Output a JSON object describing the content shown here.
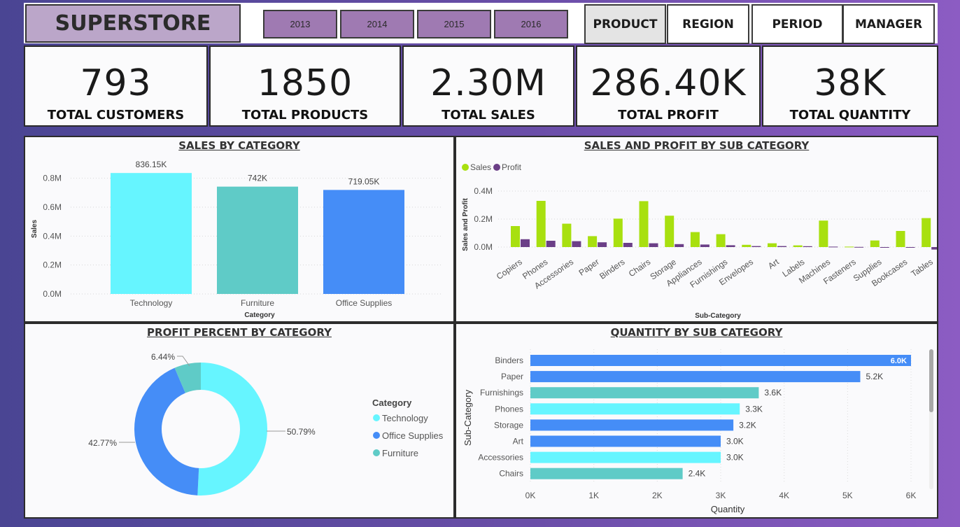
{
  "header": {
    "title": "SUPERSTORE",
    "years": [
      "2013",
      "2014",
      "2015",
      "2016"
    ],
    "nav": [
      "PRODUCT",
      "REGION",
      "PERIOD",
      "MANAGER"
    ]
  },
  "kpis": [
    {
      "value": "793",
      "label": "TOTAL CUSTOMERS"
    },
    {
      "value": "1850",
      "label": "TOTAL PRODUCTS"
    },
    {
      "value": "2.30M",
      "label": "TOTAL SALES"
    },
    {
      "value": "286.40K",
      "label": "TOTAL PROFIT"
    },
    {
      "value": "38K",
      "label": "TOTAL QUANTITY"
    }
  ],
  "charts": {
    "sales_by_category": "SALES BY CATEGORY",
    "sales_profit_sub": "SALES AND PROFIT BY SUB CATEGORY",
    "profit_percent": "PROFIT PERCENT BY CATEGORY",
    "quantity_sub": "QUANTITY BY SUB CATEGORY"
  },
  "colors": {
    "technology": "#66f5ff",
    "furniture": "#5fcbc7",
    "office_supplies": "#458df7",
    "sales": "#a8e00f",
    "profit": "#6b3f87"
  },
  "chart_data": [
    {
      "type": "bar",
      "title": "SALES BY CATEGORY",
      "categories": [
        "Technology",
        "Furniture",
        "Office Supplies"
      ],
      "values": [
        836150,
        742000,
        719050
      ],
      "data_labels": [
        "836.15K",
        "742K",
        "719.05K"
      ],
      "xlabel": "Category",
      "ylabel": "Sales",
      "ylim": [
        0,
        900000
      ],
      "yticks": [
        "0.0M",
        "0.2M",
        "0.4M",
        "0.6M",
        "0.8M"
      ],
      "grid": true
    },
    {
      "type": "bar",
      "title": "SALES AND PROFIT BY SUB CATEGORY",
      "categories": [
        "Copiers",
        "Phones",
        "Accessories",
        "Paper",
        "Binders",
        "Chairs",
        "Storage",
        "Appliances",
        "Furnishings",
        "Envelopes",
        "Art",
        "Labels",
        "Machines",
        "Fasteners",
        "Supplies",
        "Bookcases",
        "Tables"
      ],
      "series": [
        {
          "name": "Sales",
          "values": [
            150000,
            330000,
            167000,
            78000,
            203000,
            328000,
            224000,
            107000,
            92000,
            16000,
            27000,
            12000,
            189000,
            3000,
            47000,
            115000,
            207000
          ]
        },
        {
          "name": "Profit",
          "values": [
            56000,
            45000,
            42000,
            34000,
            30000,
            27000,
            21000,
            18000,
            13000,
            7000,
            7000,
            6000,
            3000,
            1000,
            -1000,
            -3000,
            -18000
          ]
        }
      ],
      "xlabel": "Sub-Category",
      "ylabel": "Sales and Profit",
      "ylim": [
        -25000,
        450000
      ],
      "yticks": [
        "0.0M",
        "0.2M",
        "0.4M"
      ],
      "legend": "top-left",
      "grid": true
    },
    {
      "type": "pie",
      "title": "PROFIT PERCENT BY CATEGORY",
      "legend_title": "Category",
      "categories": [
        "Technology",
        "Office Supplies",
        "Furniture"
      ],
      "values": [
        50.79,
        42.77,
        6.44
      ],
      "data_labels": [
        "50.79%",
        "42.77%",
        "6.44%"
      ],
      "legend": "right"
    },
    {
      "type": "bar",
      "orientation": "horizontal",
      "title": "QUANTITY BY SUB CATEGORY",
      "categories": [
        "Binders",
        "Paper",
        "Furnishings",
        "Phones",
        "Storage",
        "Art",
        "Accessories",
        "Chairs"
      ],
      "values": [
        6000,
        5200,
        3600,
        3300,
        3200,
        3000,
        3000,
        2400
      ],
      "data_labels": [
        "6.0K",
        "5.2K",
        "3.6K",
        "3.3K",
        "3.2K",
        "3.0K",
        "3.0K",
        "2.4K"
      ],
      "xlabel": "Quantity",
      "ylabel": "Sub-Category",
      "xlim": [
        0,
        6000
      ],
      "xticks": [
        "0K",
        "1K",
        "2K",
        "3K",
        "4K",
        "5K",
        "6K"
      ],
      "grid": true
    }
  ]
}
